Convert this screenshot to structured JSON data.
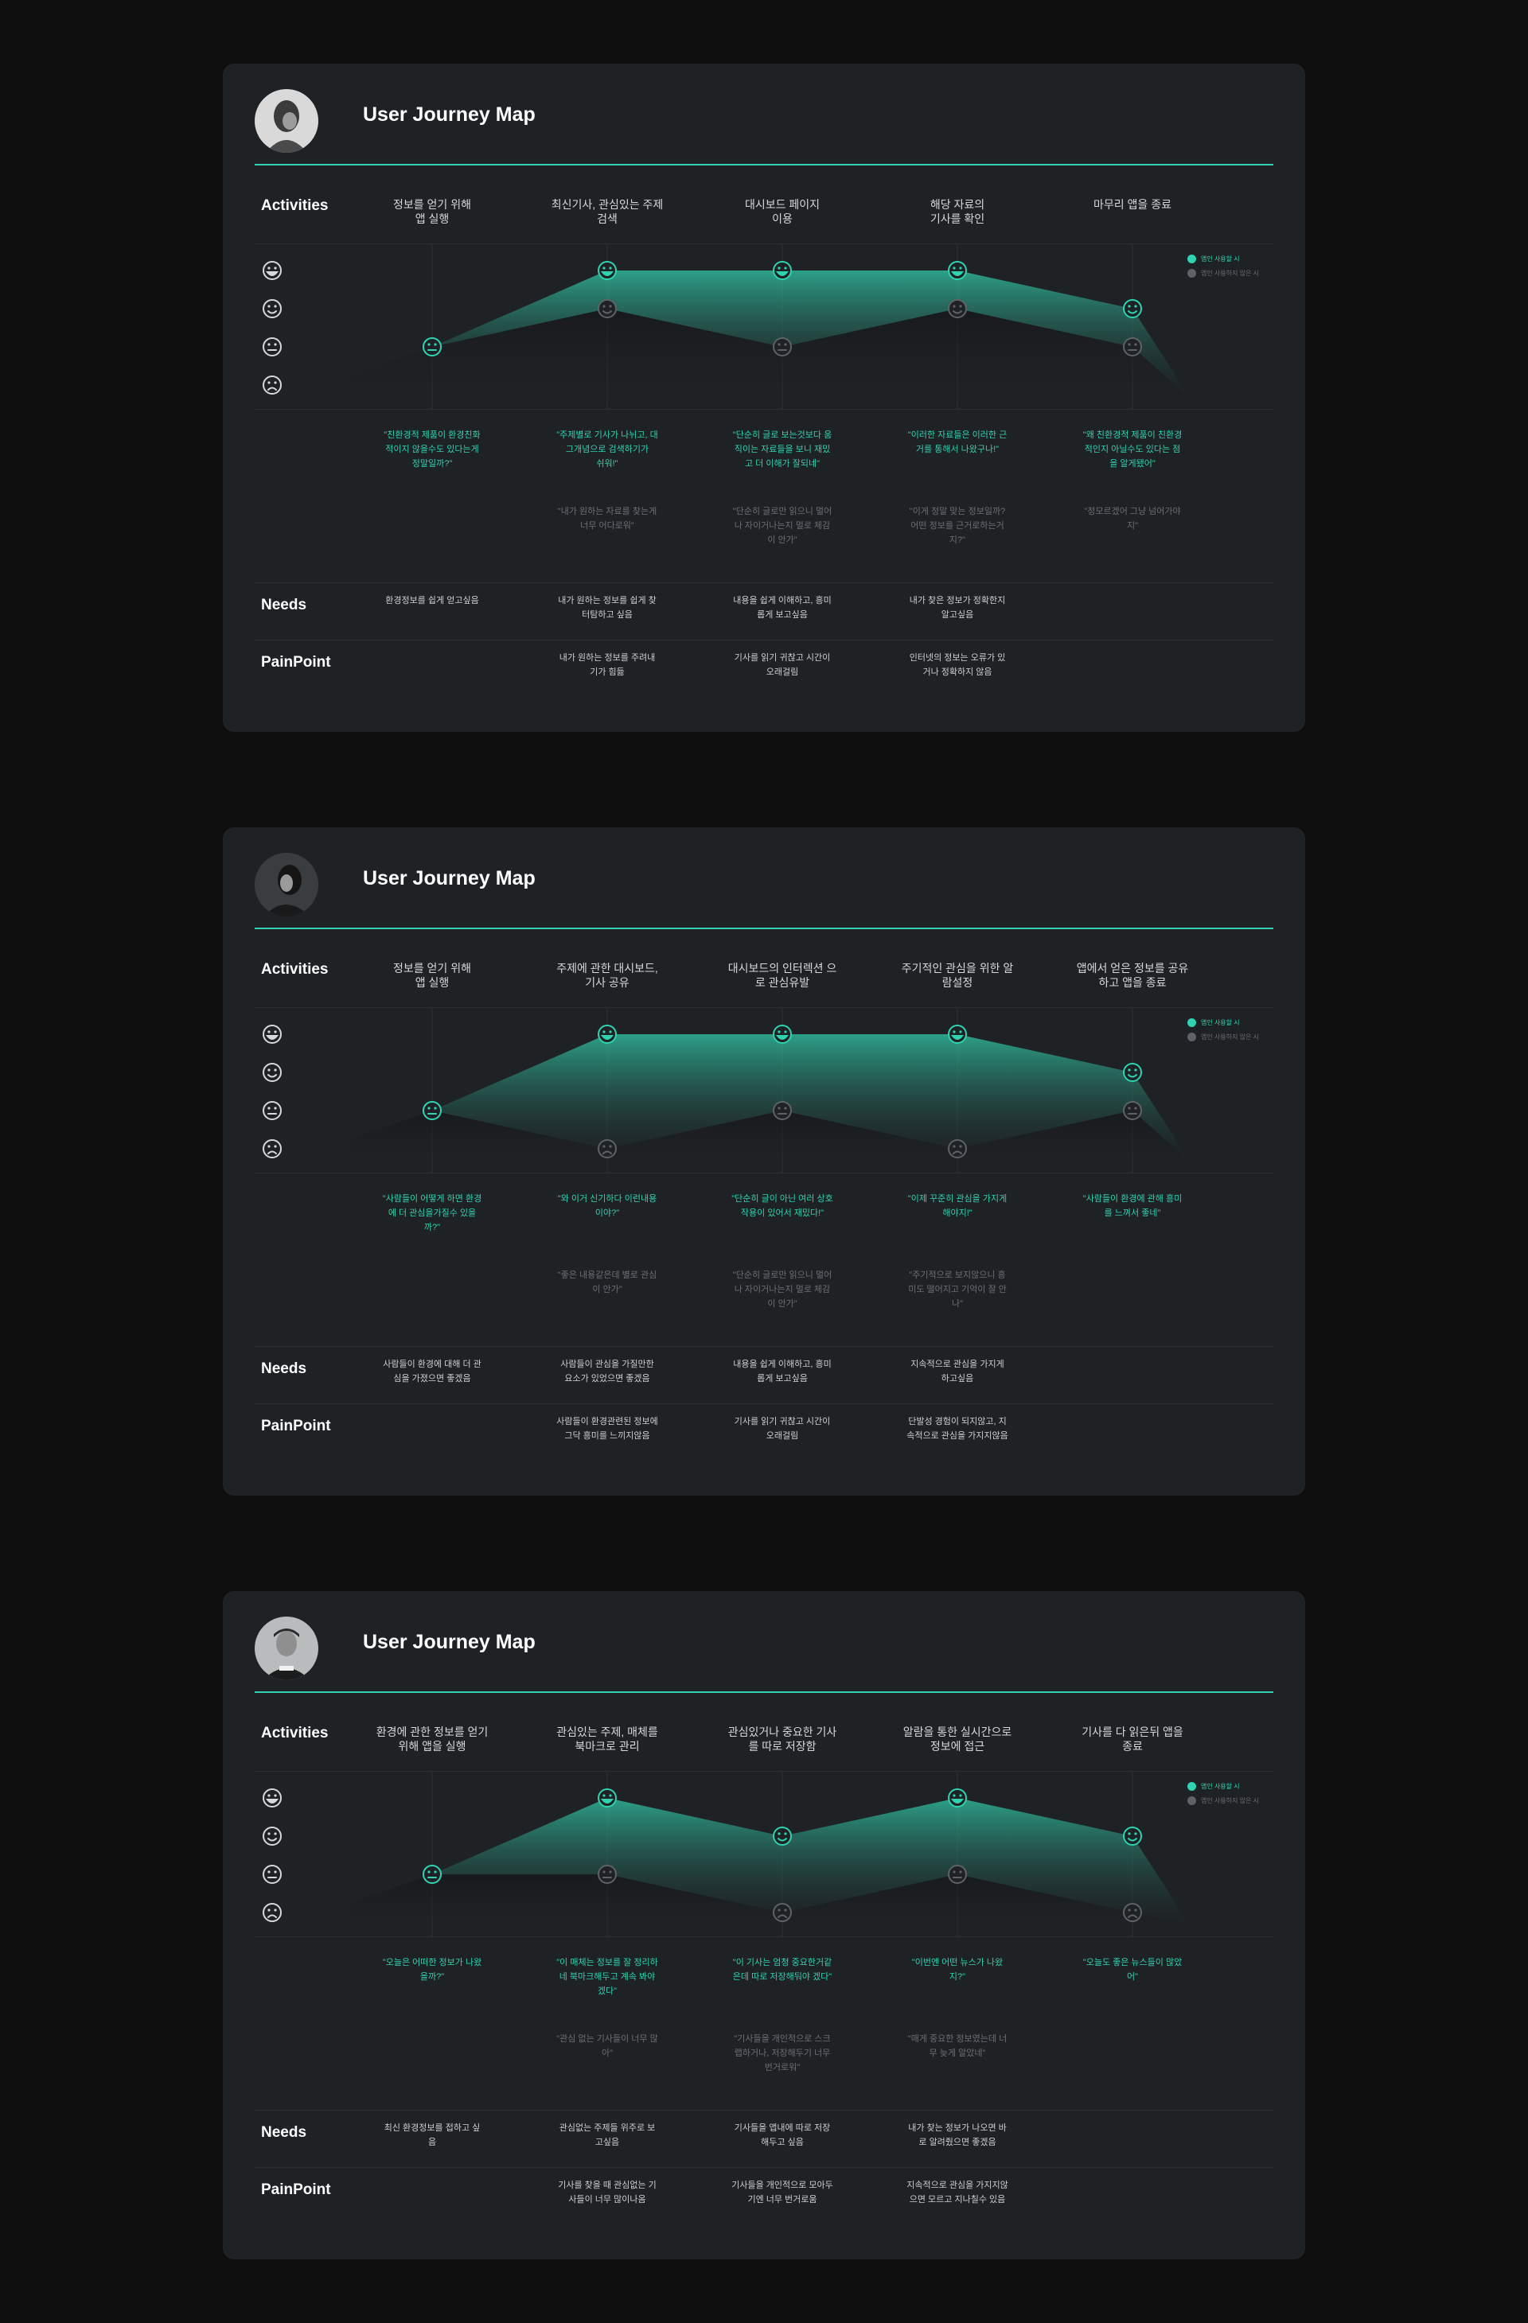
{
  "colors": {
    "accent": "#2fd3b0",
    "muted": "#5e6266",
    "card": "#1f2225",
    "page": "#0f0f10"
  },
  "legend": {
    "with_app": "앱인 사용할 시",
    "without_app": "앱인 사용하지 않은 시"
  },
  "labels": {
    "activities": "Activities",
    "needs": "Needs",
    "painpoint": "PainPoint"
  },
  "maps": [
    {
      "title": "User Journey Map",
      "avatar": "portrait-photo",
      "activities": [
        "정보를 얻기 위해\n앱 실행",
        "최신기사, 관심있는 주제\n검색",
        "대시보드 페이지\n이용",
        "해당 자료의\n기사를 확인",
        "마무리 앱을 종료"
      ],
      "quotes_positive": [
        "\"친환경적 제품이 환경친화\n적이지 않을수도 있다는게\n정말일까?\"",
        "\"주제별로 기사가 나뉘고, 대\n그개념으로 검색하기가\n쉬워!\"",
        "\"단순히 글로 보는것보다 움\n직이는 자료들을 보니 재밌\n고 더 이해가 잘되네\"",
        "\"이러한 자료들은 이러한 근\n거를 통해서 나왔구나!\"",
        "\"왜 친환경적 제품이 친환경\n적인지 아닐수도 있다는 점\n을 알게됐어\""
      ],
      "quotes_negative": [
        "",
        "\"내가 원하는 자료를 찾는게\n너무 어다로워\"",
        "\"단순히 글로만 읽으니 멀어\n나 자이거나는지 멀로 체감\n이 안가\"",
        "\"이게 정말 맞는 정보일까?\n어떤 정보를 근거로하는거\n지?\"",
        "\"정모르겠어 그냥 넘어가야\n지\""
      ],
      "needs": [
        "환경정보를 쉽게 얻고싶음",
        "내가 원하는 정보를 쉽게 찾\n터탐하고 싶음",
        "내용을 쉽게 이해하고, 흥미\n롭게 보고싶음",
        "내가 찾은 정보가 정확한지\n알고싶음",
        ""
      ],
      "painpoints": [
        "",
        "내가 원하는 정보를 주려내\n기가 힘듦",
        "기사를 읽기 귀찮고 시간이\n오래걸림",
        "인터넷의 정보는 오류가 있\n거나 정확하지 않음",
        ""
      ],
      "chart_data": {
        "type": "area",
        "scale": [
          "😆 매우 좋음",
          "🙂 좋음",
          "😐 보통",
          "☹ 나쁨"
        ],
        "ylim": [
          1,
          4
        ],
        "categories": [
          "1",
          "2",
          "3",
          "4",
          "5"
        ],
        "series": [
          {
            "name": "앱인 사용할 시",
            "values": [
              2,
              4,
              4,
              4,
              3
            ]
          },
          {
            "name": "앱인 사용하지 않은 시",
            "values": [
              2,
              3,
              2,
              3,
              2
            ]
          }
        ]
      }
    },
    {
      "title": "User Journey Map",
      "avatar": "portrait-photo",
      "activities": [
        "정보를 얻기 위해\n앱 실행",
        "주제에 관한 대시보드,\n기사 공유",
        "대시보드의 인터렉션 으\n로 관심유발",
        "주기적인 관심을 위한 알\n람설정",
        "앱에서 얻은 정보를 공유\n하고 앱을 종료"
      ],
      "quotes_positive": [
        "\"사람들이 어떻게 하면 환경\n에 더 관심을가질수 있을\n까?\"",
        "\"와 이거 신기하다 이런내용\n이야?\"",
        "\"단순히 글이 아닌 여러 상호\n작용이 있어서 재밌다!\"",
        "\"이제 꾸준히 관심을 가지게\n해야지!\"",
        "\"사람들이 환경에 관해 흥미\n를 느껴서 좋네\""
      ],
      "quotes_negative": [
        "",
        "\"좋은 내용같은데 별로 관심\n이 안가\"",
        "\"단순히 글로만 읽으니 멀어\n나 자이거나는지 멀로 체감\n이 안가\"",
        "\"주기적으로 보지않으니 흥\n미도 떨어지고 기억이 잘 안\n나\"",
        ""
      ],
      "needs": [
        "사람들이 환경에 대해 더 관\n심을 가졌으면 좋겠음",
        "사람들이 관심을 가질만한\n요소가 있었으면 좋겠음",
        "내용을 쉽게 이해하고, 흥미\n롭게 보고싶음",
        "지속적으로 관심을 가지게\n하고싶음",
        ""
      ],
      "painpoints": [
        "",
        "사람들이 환경관련된 정보에\n그닥 흥미를 느끼지않음",
        "기사를 읽기 귀찮고 시간이\n오래걸림",
        "단발성 경험이 되지않고, 지\n속적으로 관심을 가지지않음",
        ""
      ],
      "chart_data": {
        "type": "area",
        "scale": [
          "😆 매우 좋음",
          "🙂 좋음",
          "😐 보통",
          "☹ 나쁨"
        ],
        "ylim": [
          1,
          4
        ],
        "categories": [
          "1",
          "2",
          "3",
          "4",
          "5"
        ],
        "series": [
          {
            "name": "앱인 사용할 시",
            "values": [
              2,
              4,
              4,
              4,
              3
            ]
          },
          {
            "name": "앱인 사용하지 않은 시",
            "values": [
              2,
              1,
              2,
              1,
              2
            ]
          }
        ]
      }
    },
    {
      "title": "User Journey Map",
      "avatar": "portrait-photo",
      "activities": [
        "환경에 관한 정보를 얻기\n위해 앱을 실행",
        "관심있는 주제, 매체를\n북마크로 관리",
        "관심있거나 중요한 기사\n를 따로 저장함",
        "알람을 통한 실시간으로\n정보에 접근",
        "기사를 다 읽은뒤 앱을\n종료"
      ],
      "quotes_positive": [
        "\"오늘은 어떠한 정보가 나왔\n을까?\"",
        "\"이 매체는 정보를 잘 정리하\n네 북마크해두고 계속 봐야\n겠다\"",
        "\"이 기사는 엄청 중요한거같\n은데 따로 저장해둬야 겠다\"",
        "\"이번엔 어떤 뉴스가 나왔\n지?\"",
        "\"오늘도 좋은 뉴스들이 많았\n어\""
      ],
      "quotes_negative": [
        "",
        "\"관심 없는 기사들이 너무 많\n아\"",
        "\"기사들을 개인적으로 스크\n랩하거나, 저장해두기 너무\n번거로워\"",
        "\"매게 중요한 정보였는데 너\n무 늦게 알았네\"",
        ""
      ],
      "needs": [
        "최신 환경정보를 접하고 싶\n음",
        "관심없는 주제들 위주로 보\n고싶음",
        "기사들을 앱내에 따로 저장\n해두고 싶음",
        "내가 찾는 정보가 나오면 바\n로 알려줬으면 좋겠음",
        ""
      ],
      "painpoints": [
        "",
        "기사를 찾을 때 관심없는 기\n사들이 너무 많이나옴",
        "기사들을 개인적으로 모아두\n기엔 너무 번거로움",
        "지속적으로 관심을 가지지않\n으면 모르고 지나칠수 있음",
        ""
      ],
      "chart_data": {
        "type": "area",
        "scale": [
          "😆 매우 좋음",
          "🙂 좋음",
          "😐 보통",
          "☹ 나쁨"
        ],
        "ylim": [
          1,
          4
        ],
        "categories": [
          "1",
          "2",
          "3",
          "4",
          "5"
        ],
        "series": [
          {
            "name": "앱인 사용할 시",
            "values": [
              2,
              4,
              3,
              4,
              3
            ]
          },
          {
            "name": "앱인 사용하지 않은 시",
            "values": [
              2,
              2,
              1,
              2,
              1
            ]
          }
        ]
      }
    }
  ]
}
